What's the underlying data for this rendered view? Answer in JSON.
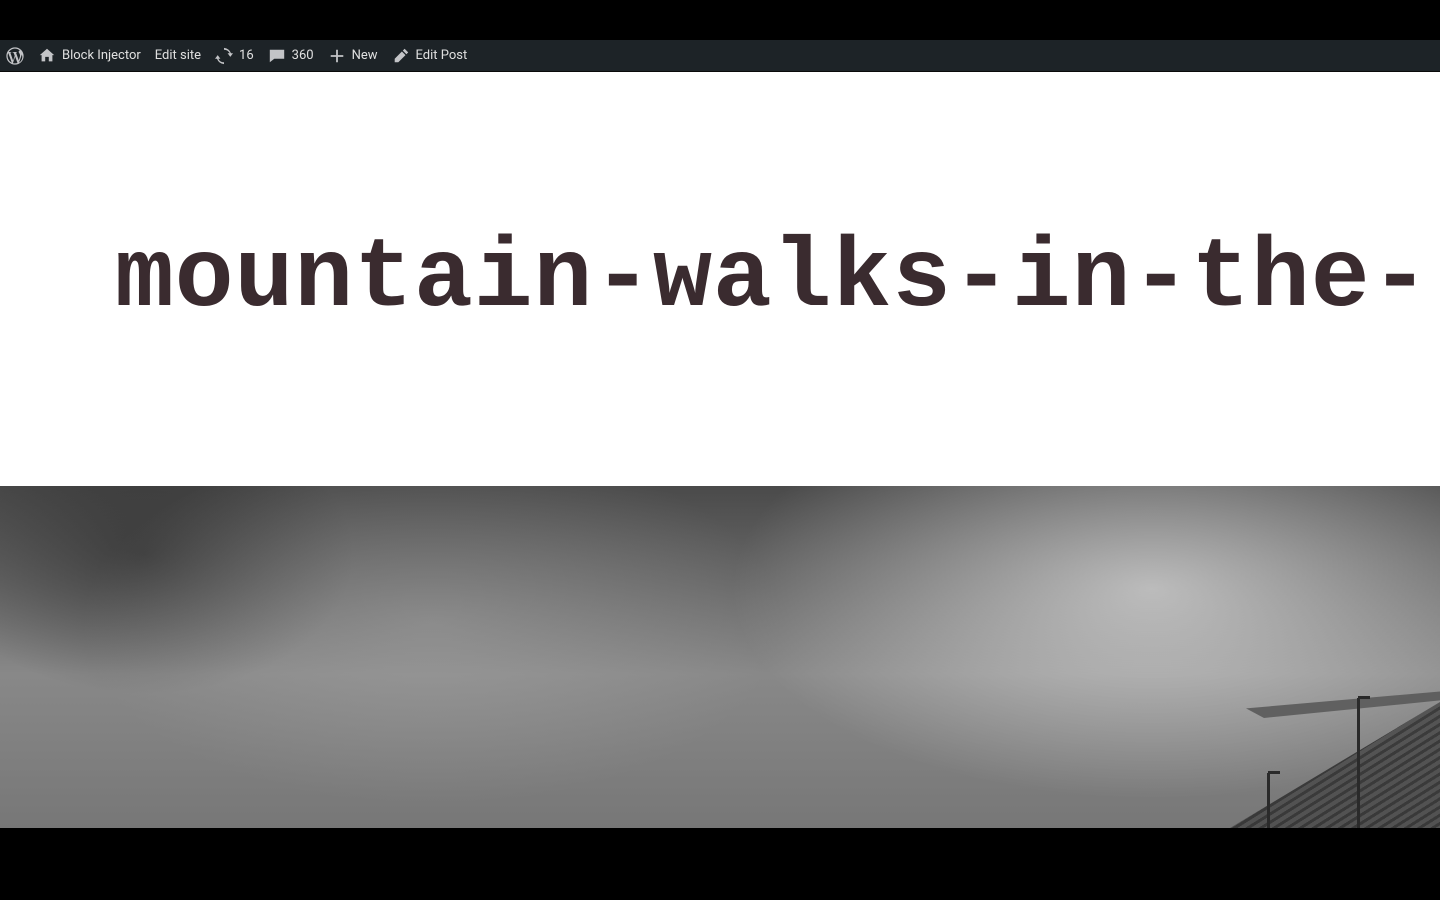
{
  "adminbar": {
    "site_name": "Block Injector",
    "edit_site": "Edit site",
    "updates_count": "16",
    "comments_count": "360",
    "new_label": "New",
    "edit_post": "Edit Post"
  },
  "post": {
    "title": "mountain-walks-in-the-"
  }
}
